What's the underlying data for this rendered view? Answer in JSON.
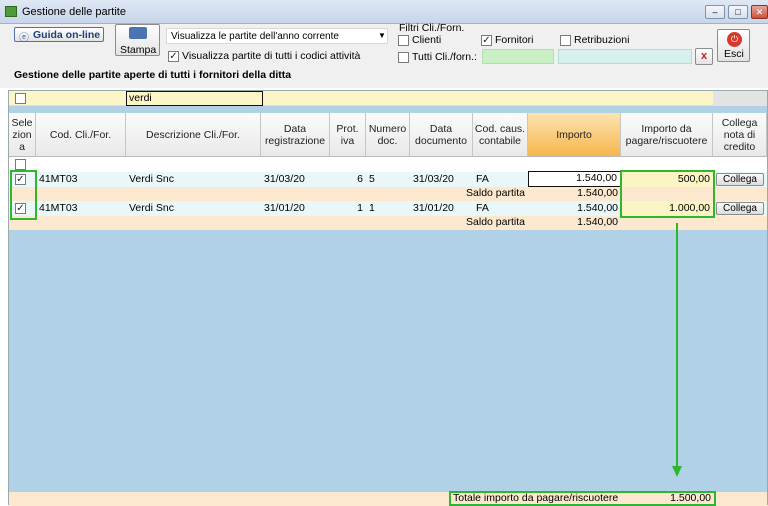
{
  "window": {
    "title": "Gestione delle partite"
  },
  "toolbar": {
    "help_label": "Guida on-line",
    "print_label": "Stampa",
    "period_select": "Visualizza le partite dell'anno corrente",
    "all_activities_label": "Visualizza partite di tutti i codici attività",
    "filters_title": "Filtri Cli./Forn.",
    "filter_clienti": "Clienti",
    "filter_fornitori": "Fornitori",
    "filter_retribuzioni": "Retribuzioni",
    "filter_tutti": "Tutti Cli./forn.:",
    "clear_label": "x",
    "exit_label": "Esci",
    "exit_icon": "power-icon",
    "section_heading": "Gestione delle partite aperte di tutti i fornitori della ditta"
  },
  "filter_row": {
    "description_value": "verdi"
  },
  "columns": {
    "sel": "Sele zion a",
    "code": "Cod. Cli./For.",
    "desc": "Descrizione Cli./For.",
    "reg_date": "Data registrazione",
    "prot": "Prot. iva",
    "num": "Numero doc.",
    "doc_date": "Data documento",
    "caus": "Cod. caus. contabile",
    "amount": "Importo",
    "to_pay": "Importo da pagare/riscuotere",
    "credit": "Collega nota di credito"
  },
  "rows": [
    {
      "checked": true,
      "code": "41MT03",
      "desc": "Verdi Snc",
      "reg_date": "31/03/20",
      "prot": "6",
      "num": "5",
      "doc_date": "31/03/20",
      "caus": "FA",
      "amount": "1.540,00",
      "to_pay": "500,00",
      "button": "Collega",
      "balance_label": "Saldo partita",
      "balance": "1.540,00"
    },
    {
      "checked": true,
      "code": "41MT03",
      "desc": "Verdi Snc",
      "reg_date": "31/01/20",
      "prot": "1",
      "num": "1",
      "doc_date": "31/01/20",
      "caus": "FA",
      "amount": "1.540,00",
      "to_pay": "1.000,00",
      "button": "Collega",
      "balance_label": "Saldo partita",
      "balance": "1.540,00"
    }
  ],
  "footer": {
    "total_label": "Totale importo da pagare/riscuotere",
    "total_value": "1.500,00"
  },
  "colors": {
    "grid_bg": "#b1d1e6",
    "highlight": "#2fb62f",
    "importo_header": "#f6b64c",
    "subtotal_row": "#fbe8cf"
  }
}
